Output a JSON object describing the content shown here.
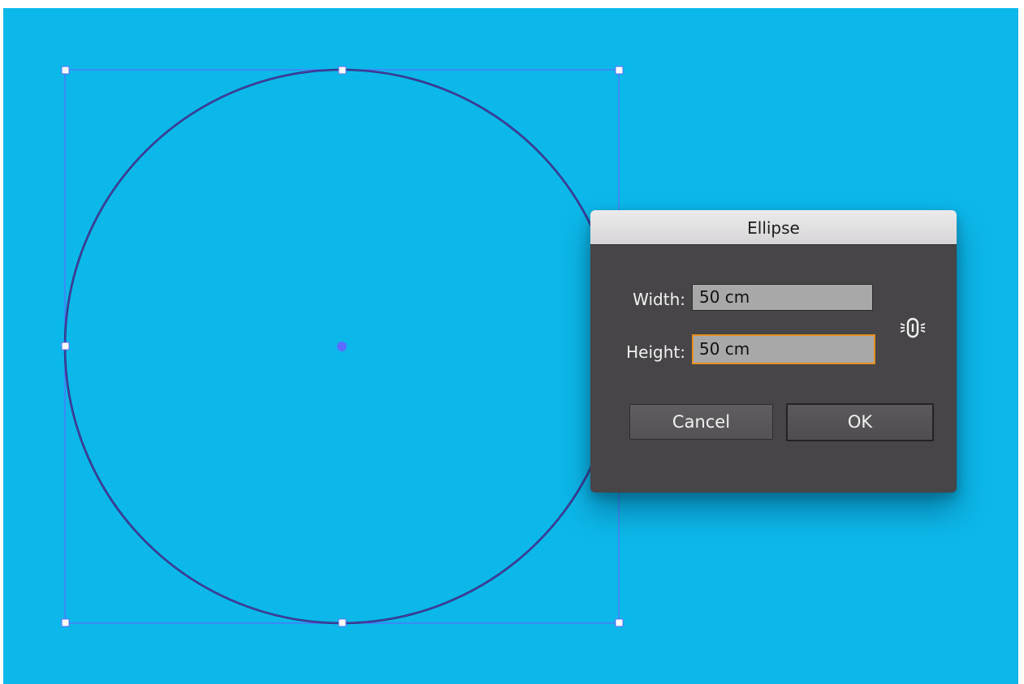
{
  "dialog": {
    "title": "Ellipse",
    "width_label": "Width:",
    "width_value": "50 cm",
    "height_label": "Height:",
    "height_value": "50 cm",
    "cancel_label": "Cancel",
    "ok_label": "OK",
    "link_icon": "constrain-proportions-link-icon"
  },
  "colors": {
    "canvas_background": "#0cb8ea",
    "selection_blue": "#5b6cff",
    "ellipse_stroke": "#2d2a6e",
    "dialog_body": "#474547",
    "focus_ring": "#e58e1f"
  }
}
